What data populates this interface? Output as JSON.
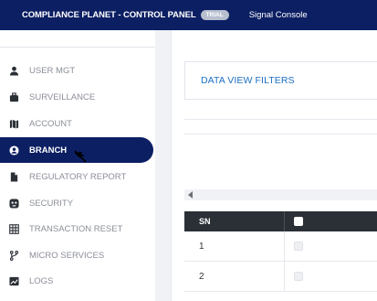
{
  "header": {
    "app_title": "COMPLIANCE PLANET - CONTROL PANEL",
    "trial_badge": "TRIAL",
    "console_link": "Signal Console"
  },
  "sidebar": {
    "items": [
      {
        "label": "USER MGT",
        "icon": "user-icon",
        "active": false
      },
      {
        "label": "SURVEILLANCE",
        "icon": "briefcase-icon",
        "active": false
      },
      {
        "label": "ACCOUNT",
        "icon": "map-icon",
        "active": false
      },
      {
        "label": "BRANCH",
        "icon": "user-circle-icon",
        "active": true
      },
      {
        "label": "REGULATORY REPORT",
        "icon": "document-icon",
        "active": false
      },
      {
        "label": "SECURITY",
        "icon": "shield-icon",
        "active": false
      },
      {
        "label": "TRANSACTION RESET",
        "icon": "grid-icon",
        "active": false
      },
      {
        "label": "MICRO SERVICES",
        "icon": "branch-icon",
        "active": false
      },
      {
        "label": "LOGS",
        "icon": "chart-icon",
        "active": false
      }
    ]
  },
  "main": {
    "filter_title": "DATA VIEW FILTERS",
    "table": {
      "columns": [
        "SN",
        ""
      ],
      "rows": [
        {
          "sn": "1"
        },
        {
          "sn": "2"
        }
      ]
    }
  },
  "colors": {
    "primary": "#0c1f63",
    "link": "#1c6fc3",
    "table_header": "#2b2f36"
  }
}
